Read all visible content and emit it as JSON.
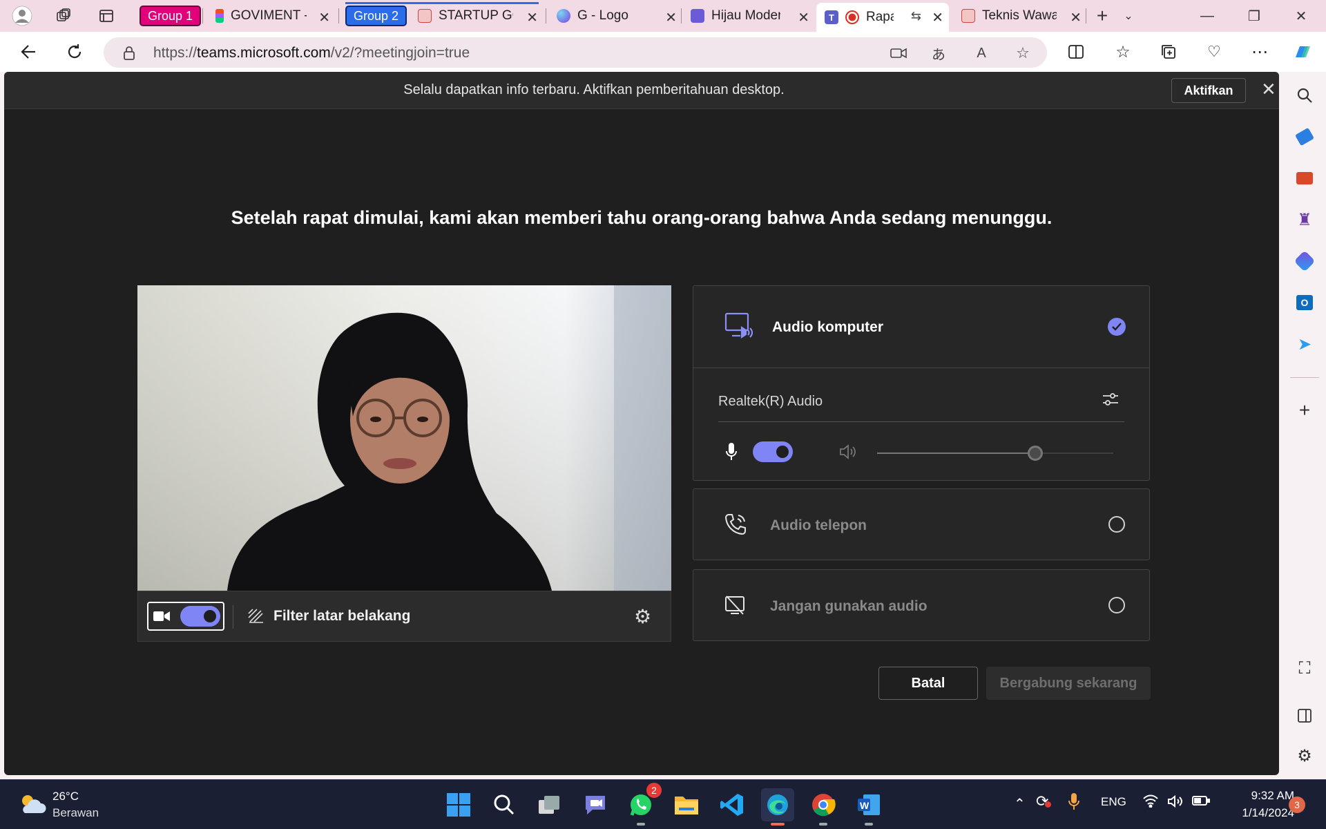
{
  "browser": {
    "tabs": [
      {
        "group": "Group 1",
        "group_color": "#e2007a",
        "title": "GOVIMENT -",
        "favicon": "figma-icon"
      },
      {
        "group": "Group 2",
        "group_color": "#2b6de8",
        "title": "STARTUP GC",
        "favicon": "pdf-icon"
      },
      {
        "title": "G - Logo",
        "favicon": "canva-icon"
      },
      {
        "title": "Hijau Moder",
        "favicon": "canva-design-icon"
      },
      {
        "title": "Rapat s",
        "favicon": "teams-icon",
        "active": true
      },
      {
        "title": "Teknis Wawa",
        "favicon": "pdf-icon"
      }
    ],
    "url_prefix": "https://",
    "url_host": "teams.microsoft.com",
    "url_path": "/v2/?meetingjoin=true"
  },
  "notification": {
    "message": "Selalu dapatkan info terbaru. Aktifkan pemberitahuan desktop.",
    "button": "Aktifkan"
  },
  "headline": "Setelah rapat dimulai, kami akan memberi tahu orang-orang bahwa Anda sedang menunggu.",
  "video": {
    "camera_on": true,
    "filter_label": "Filter latar belakang"
  },
  "audio": {
    "computer": {
      "label": "Audio komputer",
      "selected": true
    },
    "device": "Realtek(R) Audio",
    "mic_on": true,
    "speaker_volume": 0.67,
    "phone": {
      "label": "Audio telepon",
      "selected": false
    },
    "none": {
      "label": "Jangan gunakan audio",
      "selected": false
    }
  },
  "actions": {
    "cancel": "Batal",
    "join": "Bergabung sekarang"
  },
  "taskbar": {
    "weather_temp": "26°C",
    "weather_desc": "Berawan",
    "whatsapp_badge": "2",
    "language": "ENG",
    "time": "9:32 AM",
    "date": "1/14/2024",
    "notif_count": "3"
  },
  "colors": {
    "accent": "#7f85f5",
    "page_bg": "#1f1f1f",
    "tab_strip": "#f2dbe5"
  }
}
